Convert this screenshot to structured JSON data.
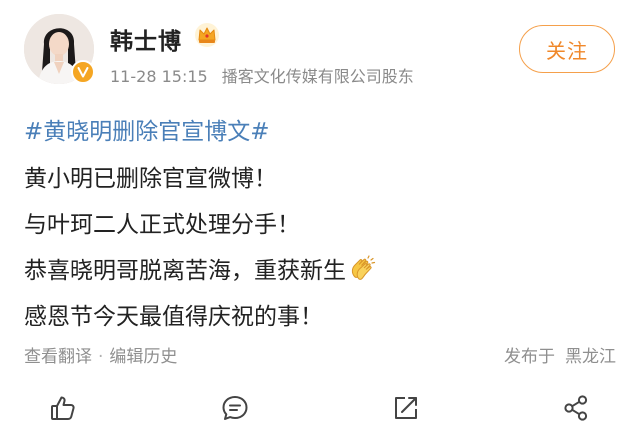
{
  "post": {
    "author": {
      "name": "韩士博",
      "badge_icon": "crown-icon",
      "verified_icon": "verified-v-icon"
    },
    "time": "11-28 15:15",
    "source": "播客文化传媒有限公司股东",
    "follow_label": "关注",
    "hashtag": "#黄晓明删除官宣博文#",
    "lines": [
      "黄小明已删除官宣微博！",
      "与叶珂二人正式处理分手！",
      "恭喜晓明哥脱离苦海，重获新生",
      "感恩节今天最值得庆祝的事！"
    ],
    "clap_icon": "clapping-hands-icon",
    "translate_label": "查看翻译",
    "separator": "·",
    "edit_history_label": "编辑历史",
    "location_prefix": "发布于",
    "location": "黑龙江",
    "actions": [
      "like-icon",
      "comment-icon",
      "repost-icon",
      "share-icon"
    ],
    "colors": {
      "link": "#4a7fb8",
      "follow": "#f0882a",
      "text": "#222222",
      "muted": "#8a8a8a"
    }
  }
}
